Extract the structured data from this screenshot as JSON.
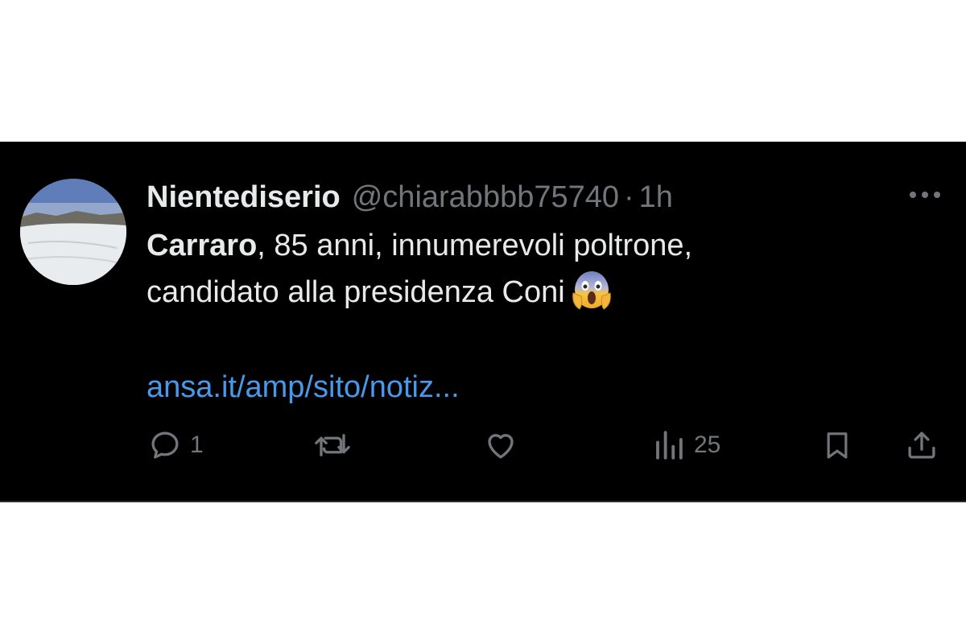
{
  "tweet": {
    "display_name": "Nientediserio",
    "handle": "@chiarabbbb75740",
    "separator": "·",
    "time": "1h",
    "text_bold": "Carraro",
    "text_line1_rest": ", 85 anni, innumerevoli poltrone,",
    "text_line2": "candidato alla presidenza Coni",
    "emoji": "face-screaming-in-fear",
    "link": "ansa.it/amp/sito/notiz..."
  },
  "actions": {
    "reply_count": "1",
    "retweet_count": "",
    "like_count": "",
    "views_count": "25"
  },
  "colors": {
    "background": "#000000",
    "primary_text": "#e7e9ea",
    "secondary_text": "#71767b",
    "link": "#4a99e9"
  },
  "icons": {
    "more": "more-horizontal-icon",
    "reply": "reply-bubble-icon",
    "retweet": "retweet-icon",
    "like": "heart-icon",
    "views": "views-bar-chart-icon",
    "bookmark": "bookmark-icon",
    "share": "share-upload-icon"
  }
}
